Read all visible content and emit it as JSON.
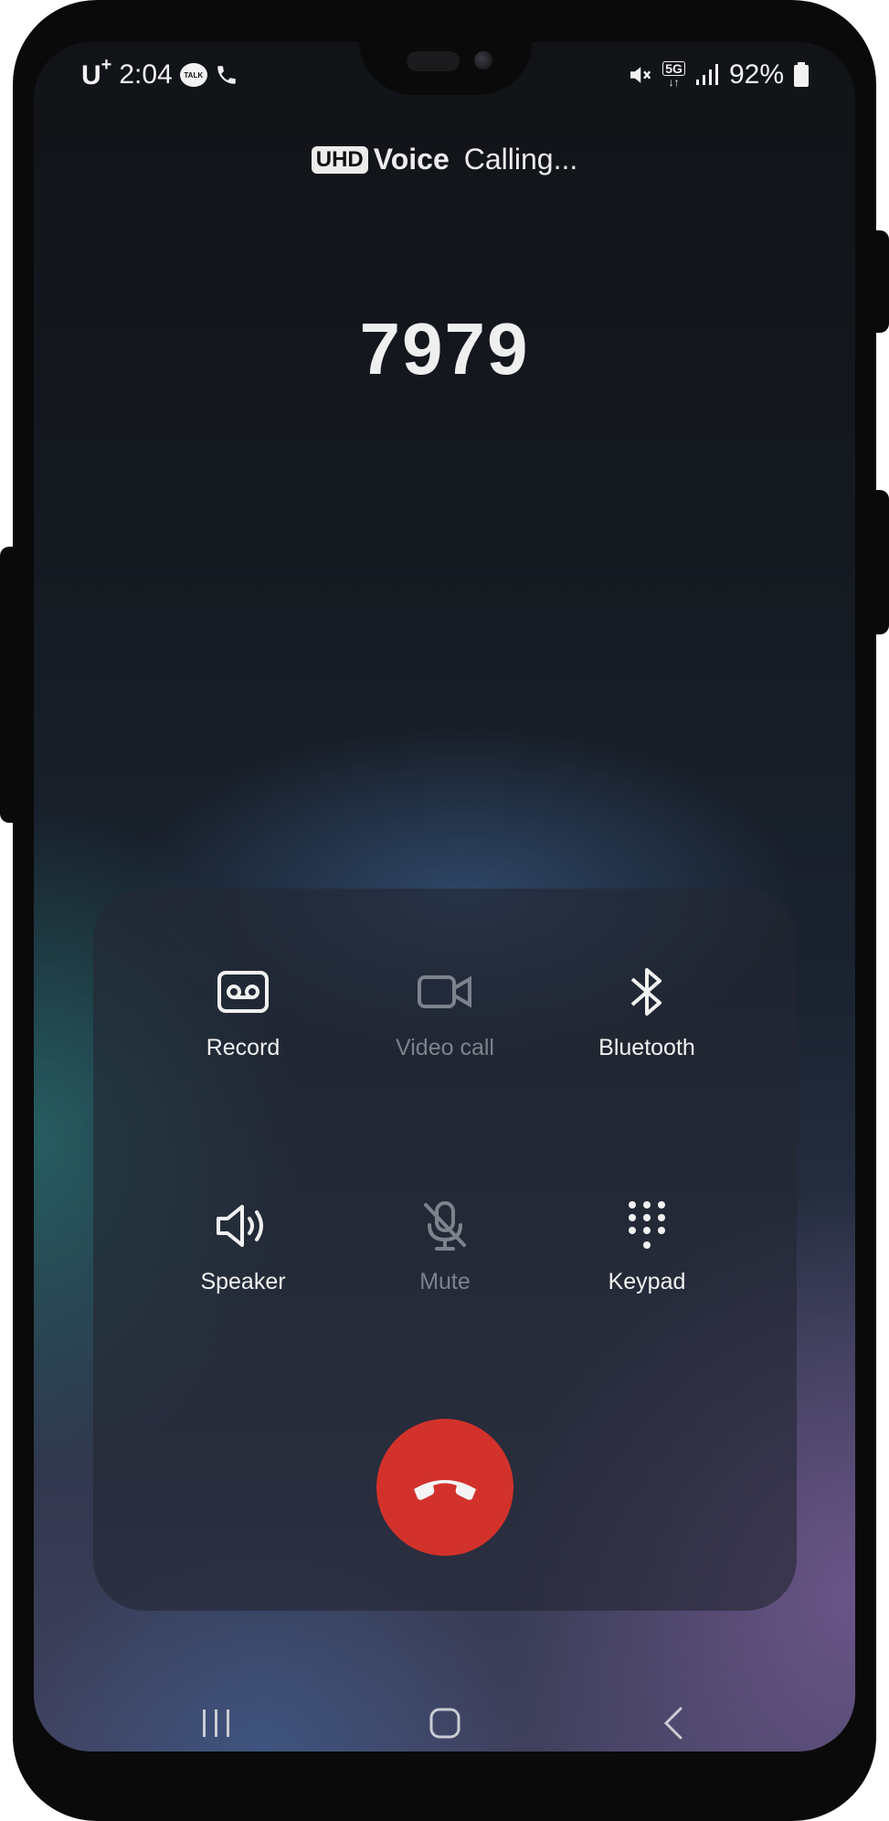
{
  "status_bar": {
    "carrier": "U",
    "carrier_plus": "+",
    "time": "2:04",
    "talk_badge": "TALK",
    "network": "5G",
    "battery": "92%"
  },
  "call": {
    "hd_badge": "UHD",
    "voice_label": "Voice",
    "status": "Calling...",
    "number": "7979"
  },
  "actions": [
    {
      "label": "Record",
      "icon": "voicemail-icon",
      "enabled": true
    },
    {
      "label": "Video call",
      "icon": "video-camera-icon",
      "enabled": false
    },
    {
      "label": "Bluetooth",
      "icon": "bluetooth-icon",
      "enabled": true
    },
    {
      "label": "Speaker",
      "icon": "speaker-icon",
      "enabled": true
    },
    {
      "label": "Mute",
      "icon": "mic-off-icon",
      "enabled": false
    },
    {
      "label": "Keypad",
      "icon": "keypad-icon",
      "enabled": true
    }
  ],
  "end_call": {
    "icon": "end-call-icon",
    "color": "#d3322c"
  },
  "nav": [
    {
      "icon": "recent-apps-icon"
    },
    {
      "icon": "home-icon"
    },
    {
      "icon": "back-icon"
    }
  ]
}
